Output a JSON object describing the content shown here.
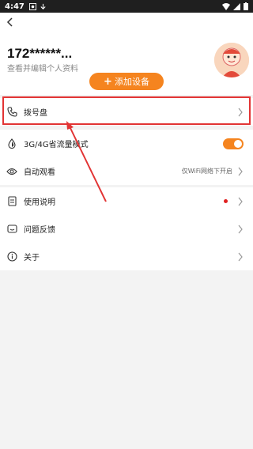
{
  "status": {
    "time": "4:47"
  },
  "profile": {
    "name": "172******...",
    "subtitle": "查看并编辑个人资料"
  },
  "buttons": {
    "add_device": "添加设备"
  },
  "menu": {
    "dialpad": "拨号盘",
    "data_saver": "3G/4G省流量模式",
    "auto_watch": "自动观看",
    "auto_watch_value": "仅WiFi网络下开启",
    "manual": "使用说明",
    "feedback": "问题反馈",
    "about": "关于"
  },
  "colors": {
    "accent": "#f5841f",
    "highlight": "#e23434"
  },
  "toggles": {
    "data_saver_on": true
  },
  "icons": {
    "back": "chevron-left-icon",
    "dialpad": "phone-icon",
    "data_saver": "droplet-icon",
    "auto_watch": "eye-icon",
    "manual": "document-icon",
    "feedback": "chat-icon",
    "about": "info-icon"
  }
}
